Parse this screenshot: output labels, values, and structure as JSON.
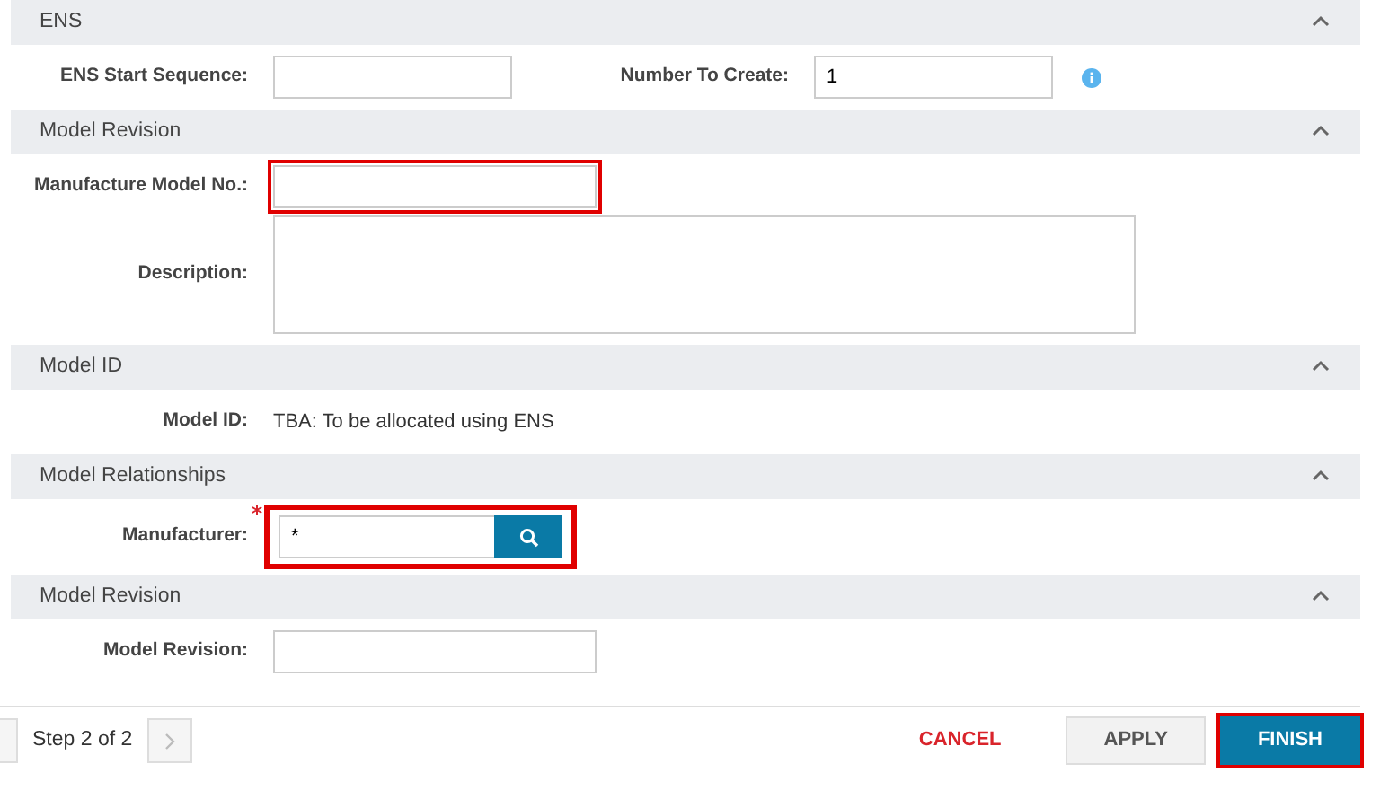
{
  "sections": [
    {
      "title": "ENS",
      "expanded": true,
      "rows": [
        [
          {
            "kind": "text",
            "label": "ENS Start Sequence:"
          },
          {
            "kind": "text",
            "label": "Number To Create:",
            "value": "1",
            "info": true
          }
        ]
      ]
    },
    {
      "title": "Model Revision",
      "expanded": true,
      "rows": [
        [
          {
            "kind": "text",
            "label": "Manufacture Model No.:",
            "highlighted": true
          }
        ],
        [
          {
            "kind": "textarea",
            "label": "Description:"
          }
        ]
      ]
    },
    {
      "title": "Model ID",
      "expanded": true,
      "rows": [
        [
          {
            "kind": "static",
            "label": "Model ID:",
            "value": "TBA: To be allocated using ENS"
          }
        ]
      ]
    },
    {
      "title": "Model Relationships",
      "expanded": true,
      "rows": [
        [
          {
            "kind": "lookup",
            "label": "Manufacturer:",
            "value": "*",
            "required": true,
            "highlighted": true
          }
        ]
      ]
    },
    {
      "title": "Model Revision",
      "expanded": true,
      "rows": [
        [
          {
            "kind": "text",
            "label": "Model Revision:"
          }
        ]
      ]
    }
  ],
  "footer": {
    "step": "Step 2 of 2",
    "next_disabled": true,
    "buttons": [
      {
        "kind": "link",
        "label": "CANCEL"
      },
      {
        "kind": "secondary",
        "label": "APPLY"
      },
      {
        "kind": "primary",
        "label": "FINISH",
        "highlighted": true
      }
    ]
  }
}
